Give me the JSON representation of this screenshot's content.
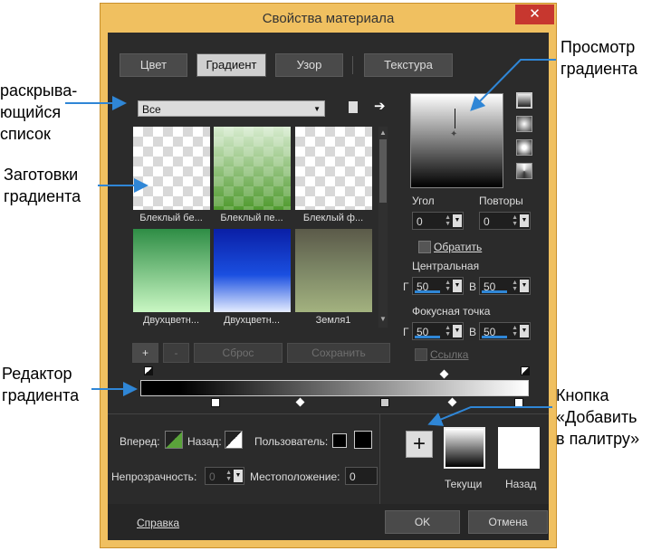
{
  "window": {
    "title": "Свойства материала",
    "close_label": "✕"
  },
  "tabs": [
    {
      "label": "Цвет",
      "active": false
    },
    {
      "label": "Градиент",
      "active": true
    },
    {
      "label": "Узор",
      "active": false
    },
    {
      "label": "Текстура",
      "active": false
    }
  ],
  "library": {
    "dropdown_value": "Все"
  },
  "presets": [
    {
      "label": "Блеклый бе..."
    },
    {
      "label": "Блеклый пе..."
    },
    {
      "label": "Блеклый ф..."
    },
    {
      "label": "Двухцветн..."
    },
    {
      "label": "Двухцветн..."
    },
    {
      "label": "Земля1"
    }
  ],
  "preset_buttons": {
    "add": "+",
    "remove": "-",
    "reset": "Сброс",
    "save": "Сохранить"
  },
  "properties": {
    "angle_label": "Угол",
    "angle_value": "0",
    "repeats_label": "Повторы",
    "repeats_value": "0",
    "invert_label": "Обратить",
    "center_label": "Центральная",
    "center_h_label": "Г",
    "center_h_value": "50",
    "center_v_label": "В",
    "center_v_value": "50",
    "focal_label": "Фокусная точка",
    "focal_h_label": "Г",
    "focal_h_value": "50",
    "focal_v_label": "В",
    "focal_v_value": "50",
    "link_label": "Ссылка"
  },
  "editor_controls": {
    "forward_label": "Вперед:",
    "back_label": "Назад:",
    "user_label": "Пользователь:",
    "opacity_label": "Непрозрачность:",
    "opacity_value": "0",
    "location_label": "Местоположение:",
    "location_value": "0"
  },
  "palette": {
    "add_label": "+",
    "current_label": "Текущи",
    "back_label": "Назад"
  },
  "footer": {
    "help_link": "Справка",
    "ok": "OK",
    "cancel": "Отмена"
  },
  "annotations": {
    "dropdown": [
      "раскрыва-",
      "ющийся",
      "список"
    ],
    "presets": [
      "Заготовки",
      "градиента"
    ],
    "preview": [
      "Просмотр",
      "градиента"
    ],
    "editor": [
      "Редактор",
      "градиента"
    ],
    "add_palette": [
      "Кнопка",
      "«Добавить",
      "в палитру»"
    ]
  },
  "colors": {
    "accent": "#2f86d6",
    "frame": "#f0c060",
    "dark_bg": "#2b2b2b",
    "close": "#c7372f"
  }
}
